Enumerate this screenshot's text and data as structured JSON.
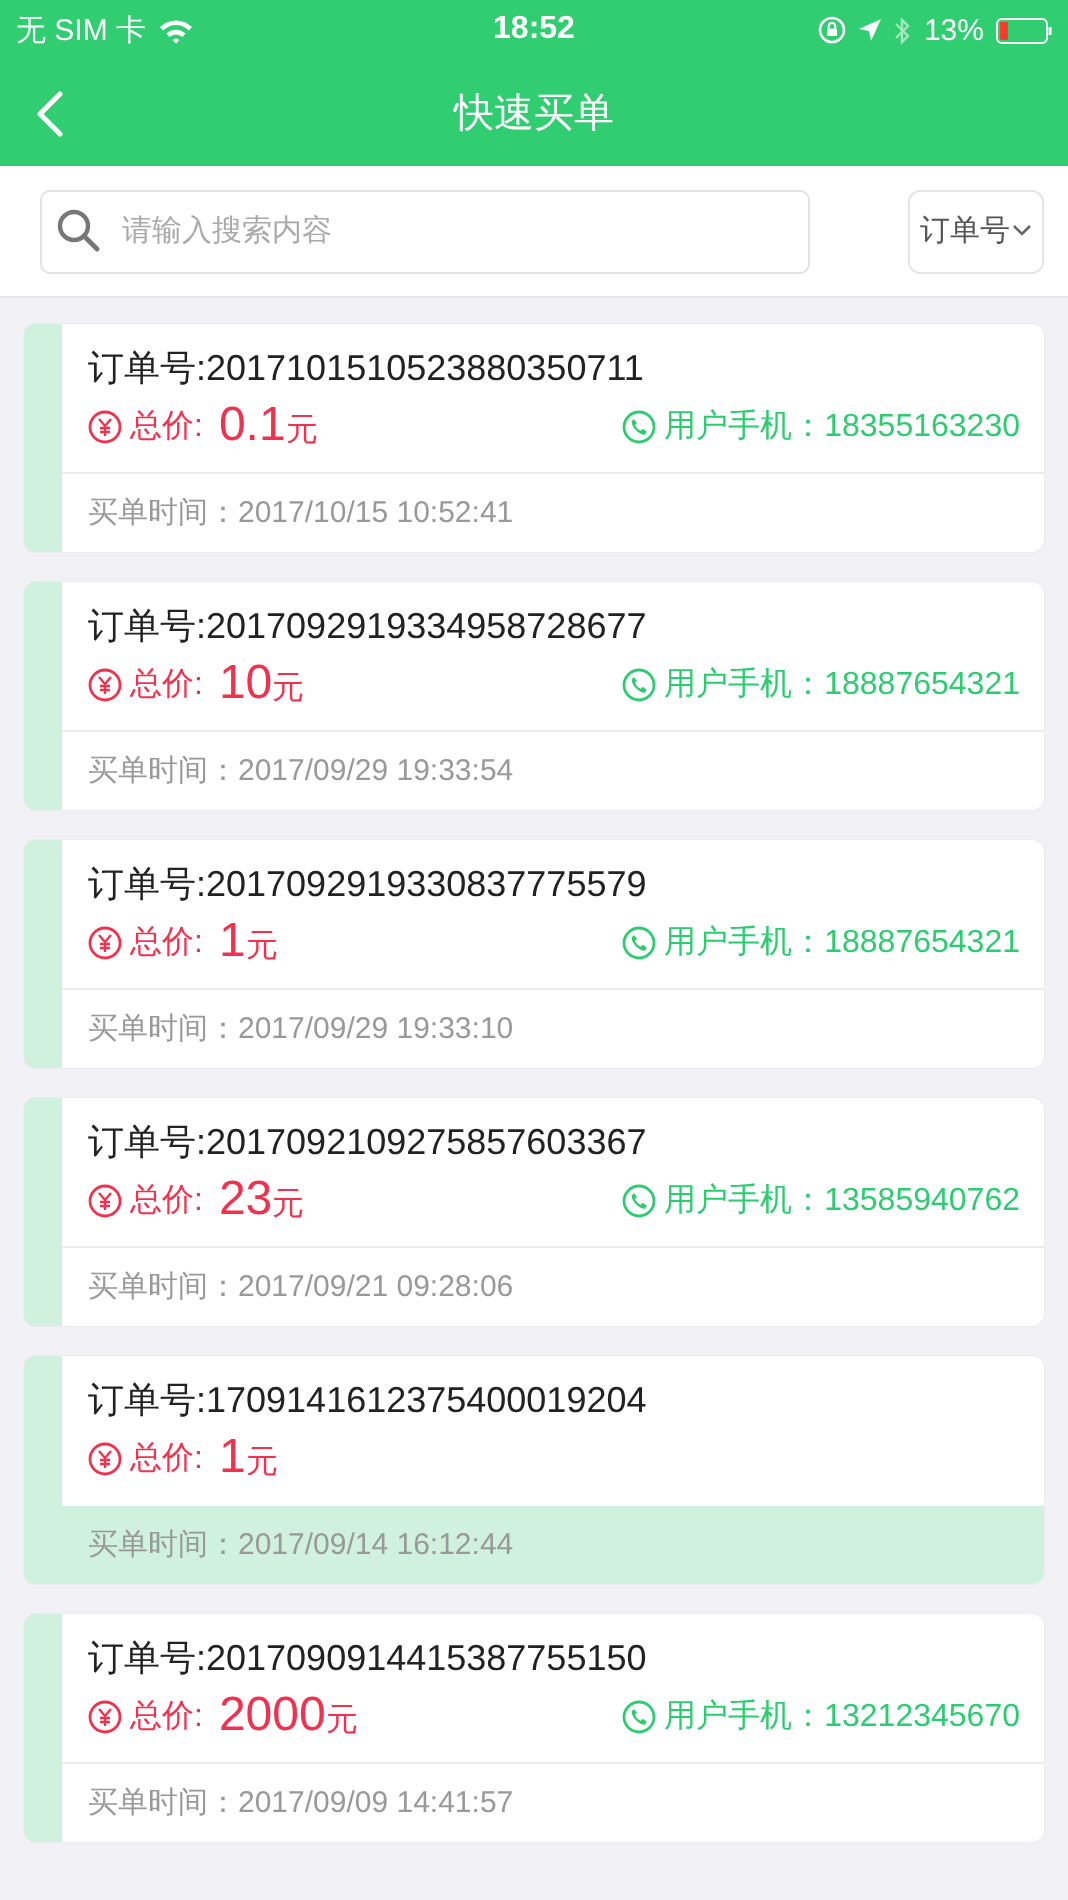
{
  "status_bar": {
    "carrier": "无 SIM 卡",
    "time": "18:52",
    "battery": "13%"
  },
  "nav": {
    "title": "快速买单"
  },
  "search": {
    "placeholder": "请输入搜索内容",
    "filter": "订单号"
  },
  "orders": [
    {
      "order_label": "订单号:",
      "order_no": "2017101510523880350711",
      "price_label": "总价:",
      "price": "0.1",
      "unit": "元",
      "phone_label": "用户手机：",
      "phone": "18355163230",
      "time_label": "买单时间：",
      "time": "2017/10/15 10:52:41",
      "highlighted": false
    },
    {
      "order_label": "订单号:",
      "order_no": "2017092919334958728677",
      "price_label": "总价:",
      "price": "10",
      "unit": "元",
      "phone_label": "用户手机：",
      "phone": "18887654321",
      "time_label": "买单时间：",
      "time": "2017/09/29 19:33:54",
      "highlighted": false
    },
    {
      "order_label": "订单号:",
      "order_no": "2017092919330837775579",
      "price_label": "总价:",
      "price": "1",
      "unit": "元",
      "phone_label": "用户手机：",
      "phone": "18887654321",
      "time_label": "买单时间：",
      "time": "2017/09/29 19:33:10",
      "highlighted": false
    },
    {
      "order_label": "订单号:",
      "order_no": "2017092109275857603367",
      "price_label": "总价:",
      "price": "23",
      "unit": "元",
      "phone_label": "用户手机：",
      "phone": "13585940762",
      "time_label": "买单时间：",
      "time": "2017/09/21 09:28:06",
      "highlighted": false
    },
    {
      "order_label": "订单号:",
      "order_no": "1709141612375400019204",
      "price_label": "总价:",
      "price": "1",
      "unit": "元",
      "time_label": "买单时间：",
      "time": "2017/09/14 16:12:44",
      "highlighted": true
    },
    {
      "order_label": "订单号:",
      "order_no": "2017090914415387755150",
      "price_label": "总价:",
      "price": "2000",
      "unit": "元",
      "phone_label": "用户手机：",
      "phone": "13212345670",
      "time_label": "买单时间：",
      "time": "2017/09/09 14:41:57",
      "highlighted": false
    }
  ]
}
